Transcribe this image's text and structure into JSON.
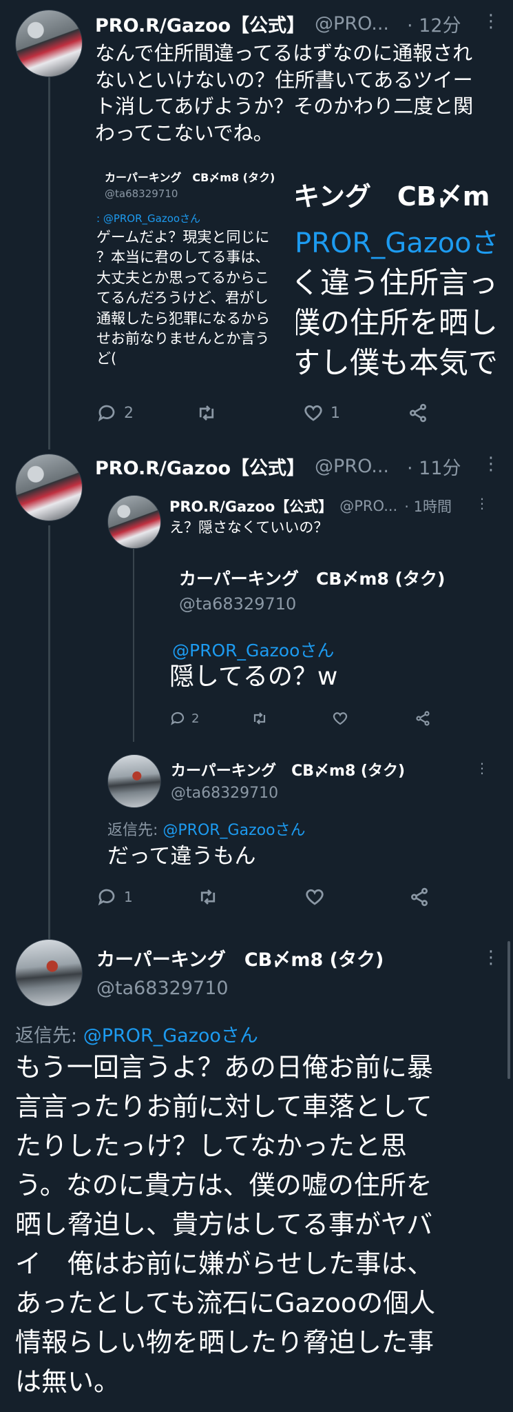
{
  "tweet1": {
    "name": "PRO.R/Gazoo【公式】",
    "handle": "@PRO...",
    "time": "· 12分",
    "text_lines": [
      "なんで住所間違ってるはずなのに通報され",
      "ないといけないの？住所書いてあるツイー",
      "ト消してあげようか？そのかわり二度と関",
      "わってこないでね。"
    ],
    "image": {
      "left_name": "カーパーキング　CB〆m8 (タク)",
      "left_handle": "@ta68329710",
      "left_reply": ": @PROR_Gazooさん",
      "left_lines": [
        "ゲームだよ？現実と同じに",
        "？本当に君のしてる事は、",
        "大丈夫とか思ってるからこ",
        "てるんだろうけど、君がし",
        "通報したら犯罪になるから",
        "せお前なりませんとか言う",
        "ど("
      ],
      "right_name": "キング　CB〆m",
      "right_reply": "PROR_Gazooさ",
      "right_lines": [
        "く違う住所言っ",
        "僕の住所を晒し",
        "すし僕も本気で"
      ]
    },
    "actions": {
      "reply": "2",
      "retweet": "",
      "like": "1"
    }
  },
  "tweet2": {
    "name": "PRO.R/Gazoo【公式】",
    "handle": "@PRO...",
    "time": "· 11分",
    "quoted1": {
      "name": "PRO.R/Gazoo【公式】",
      "handle": "@PRO...",
      "time": "· 1時間",
      "text": "え？隠さなくていいの？",
      "inner": {
        "name": "カーパーキング　CB〆m8 (タク)",
        "handle": "@ta68329710",
        "reply": "@PROR_Gazooさん",
        "text": "隠してるの？w"
      },
      "actions": {
        "reply": "2"
      }
    },
    "quoted2": {
      "name": "カーパーキング　CB〆m8 (タク)",
      "handle": "@ta68329710",
      "reply_prefix": "返信先: ",
      "reply_to": "@PROR_Gazooさん",
      "text": "だって違うもん",
      "actions": {
        "reply": "1"
      }
    }
  },
  "main": {
    "name": "カーパーキング　CB〆m8 (タク)",
    "handle": "@ta68329710",
    "reply_prefix": "返信先: ",
    "reply_to": "@PROR_Gazooさん",
    "text_lines": [
      "もう一回言うよ？あの日俺お前に暴",
      "言言ったりお前に対して車落として",
      "たりしたっけ？してなかったと思",
      "う。なのに貴方は、僕の嘘の住所を",
      "晒し脅迫し、貴方はしてる事がヤバ",
      "イ　俺はお前に嫌がらせした事は、",
      "あったとしても流石にGazooの個人",
      "情報らしい物を晒したり脅迫した事",
      "は無い。"
    ]
  },
  "colors": {
    "background": "#15202b",
    "text": "#ffffff",
    "secondary": "#8b98a5",
    "link": "#1d9bf0",
    "border": "#38444d"
  }
}
